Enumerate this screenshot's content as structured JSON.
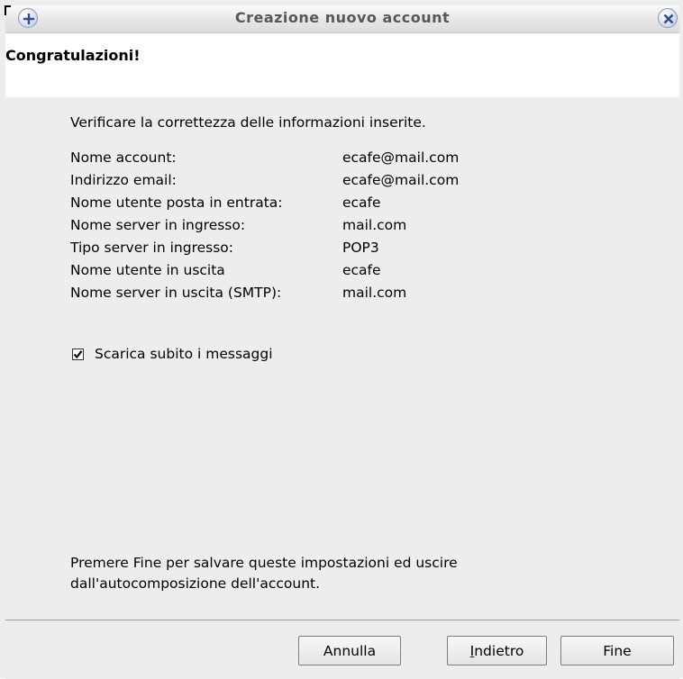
{
  "window": {
    "title": "Creazione nuovo account"
  },
  "header": {
    "title": "Congratulazioni!"
  },
  "content": {
    "intro": "Verificare la correttezza delle informazioni inserite.",
    "rows": [
      {
        "label": "Nome account:",
        "value": "ecafe@mail.com"
      },
      {
        "label": "Indirizzo email:",
        "value": "ecafe@mail.com"
      },
      {
        "label": "Nome utente posta in entrata:",
        "value": "ecafe"
      },
      {
        "label": "Nome server in ingresso:",
        "value": "mail.com"
      },
      {
        "label": "Tipo server in ingresso:",
        "value": "POP3"
      },
      {
        "label": "Nome utente in uscita",
        "value": "ecafe"
      },
      {
        "label": "Nome server in uscita (SMTP):",
        "value": "mail.com"
      }
    ],
    "checkbox": {
      "label": "Scarica subito i messaggi",
      "checked": true
    },
    "footer_line1": "Premere Fine per salvare queste impostazioni ed uscire",
    "footer_line2": "dall'autocomposizione dell'account."
  },
  "buttons": {
    "cancel": "Annulla",
    "back_key": "I",
    "back_rest": "ndietro",
    "finish": "Fine"
  },
  "icons": {
    "titlebar_left": "add-icon",
    "titlebar_right": "close-icon"
  },
  "colors": {
    "header_bg": "#ffffff",
    "body_bg": "#ededed",
    "title_text": "#575757"
  }
}
